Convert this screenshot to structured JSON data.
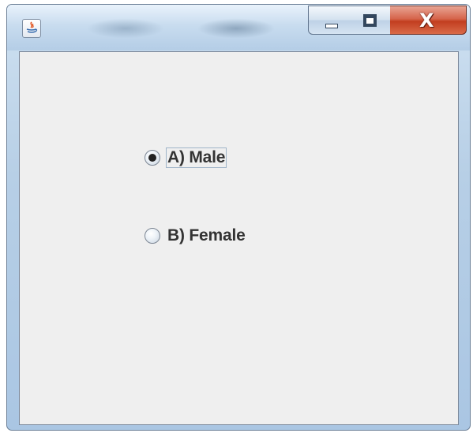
{
  "window": {
    "title": "",
    "controls": {
      "minimize_icon": "minimize-icon",
      "maximize_icon": "maximize-icon",
      "close_glyph": "X"
    }
  },
  "form": {
    "options": [
      {
        "label": "A) Male",
        "selected": true,
        "focused": true
      },
      {
        "label": "B) Female",
        "selected": false,
        "focused": false
      }
    ]
  },
  "colors": {
    "content_background": "#efefef",
    "close_button": "#c23e20",
    "label_text": "#333333"
  }
}
